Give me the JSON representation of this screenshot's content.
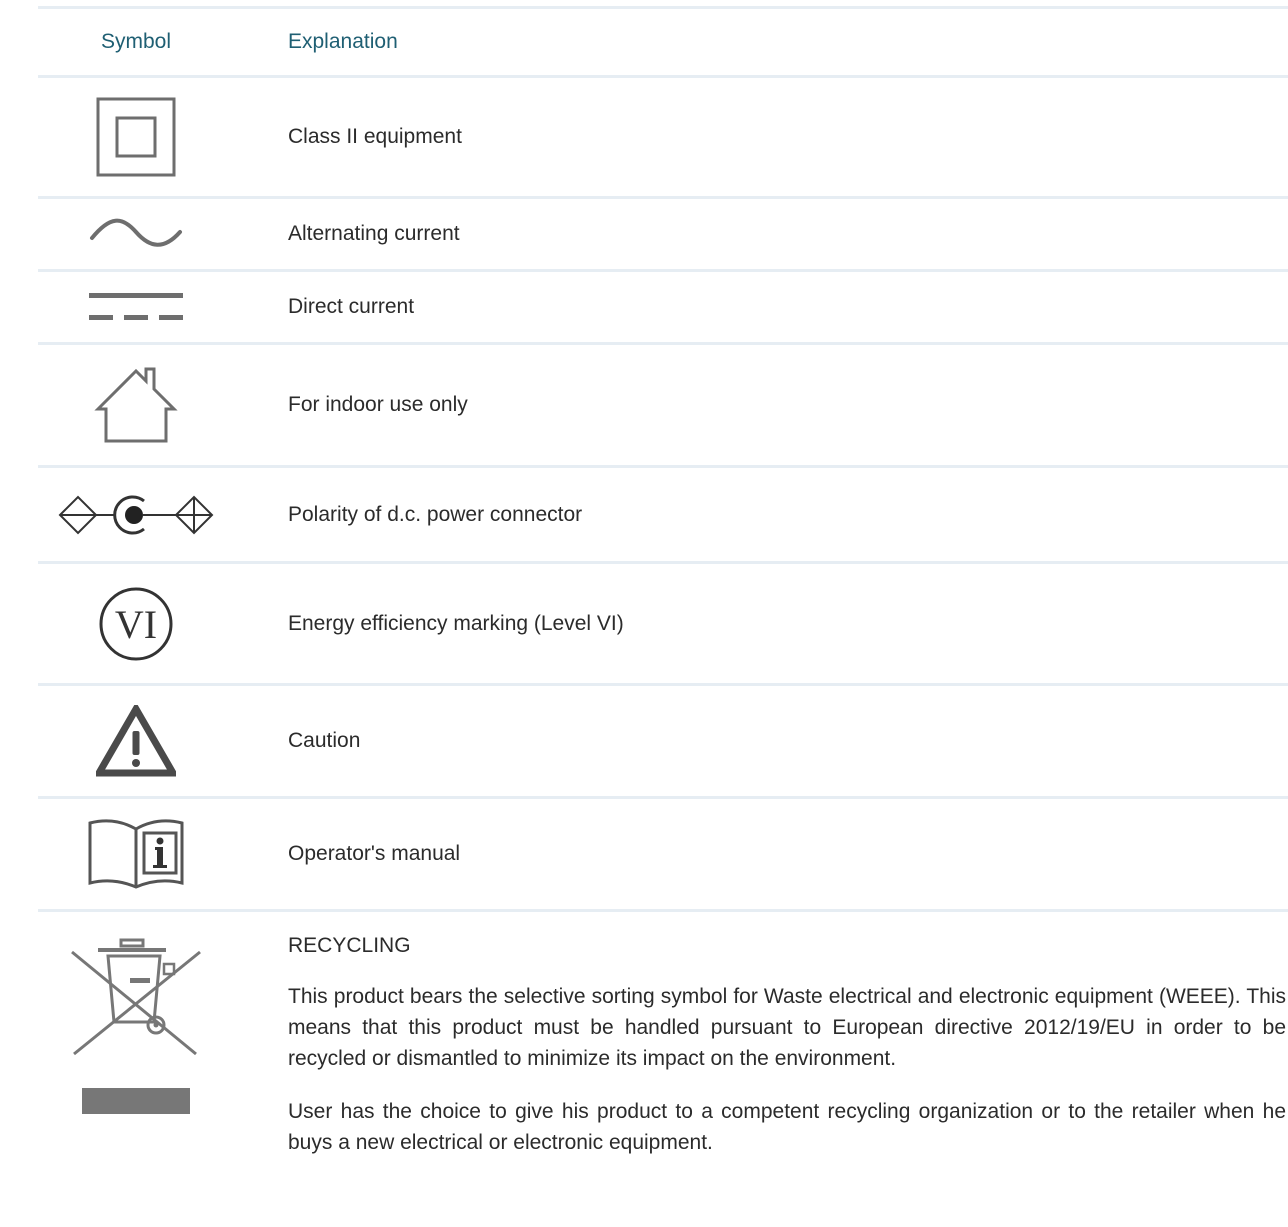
{
  "table": {
    "header": {
      "symbol": "Symbol",
      "explanation": "Explanation"
    },
    "rows": [
      {
        "icon": "class-ii-equipment-icon",
        "explanation": "Class II equipment"
      },
      {
        "icon": "alternating-current-icon",
        "explanation": "Alternating current"
      },
      {
        "icon": "direct-current-icon",
        "explanation": "Direct current"
      },
      {
        "icon": "indoor-use-icon",
        "explanation": "For indoor use only"
      },
      {
        "icon": "dc-polarity-icon",
        "explanation": "Polarity of d.c. power connector"
      },
      {
        "icon": "energy-efficiency-vi-icon",
        "explanation": "Energy efficiency marking (Level VI)",
        "icon_text": "VI"
      },
      {
        "icon": "caution-icon",
        "explanation": "Caution"
      },
      {
        "icon": "operator-manual-icon",
        "explanation": "Operator's manual"
      }
    ],
    "recycling": {
      "icon": "weee-crossed-bin-icon",
      "heading": "RECYCLING",
      "paragraphs": [
        "This product bears the selective sorting symbol for Waste electrical and electronic equipment (WEEE). This means that this product must be handled pursuant to European directive 2012/19/EU in order to be recycled or dismantled to minimize its impact on the environment.",
        "User has the choice to give his product to a competent recycling organization or to the retailer when he buys a new electrical or electronic equipment."
      ]
    }
  },
  "colors": {
    "header_text": "#1f5f73",
    "rule": "#e6edf3",
    "icon_gray": "#6e6e6e"
  }
}
